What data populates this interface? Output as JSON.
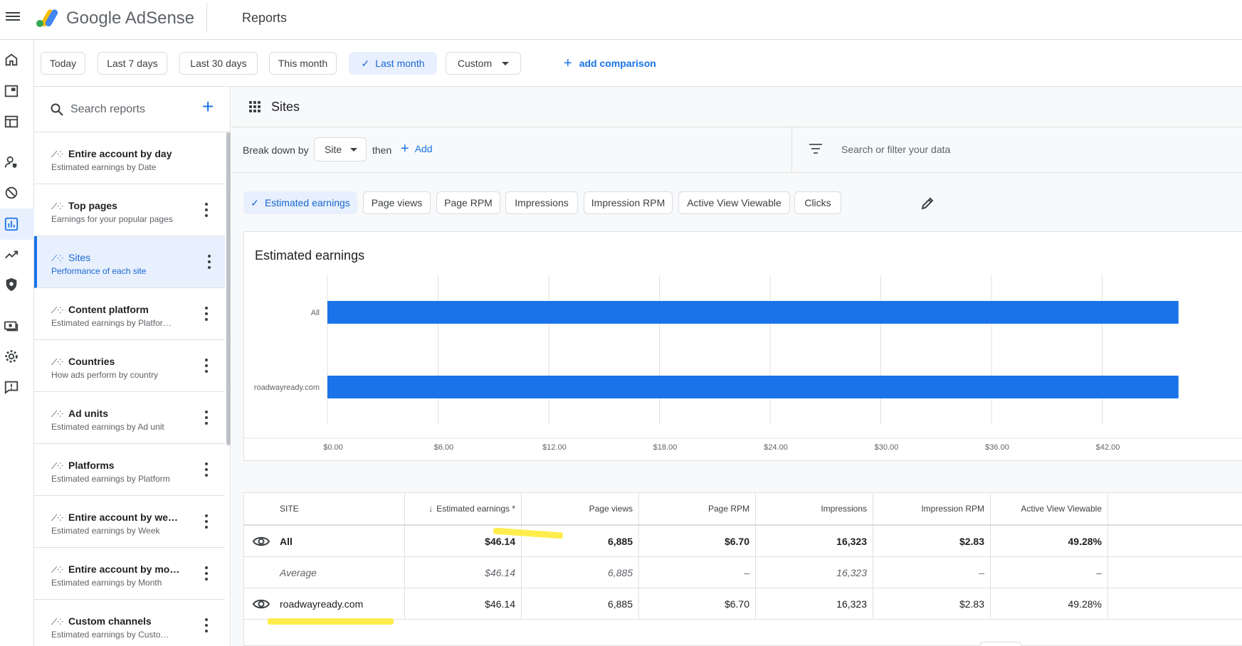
{
  "header": {
    "brand": "Google AdSense",
    "page_title": "Reports"
  },
  "rail": {
    "icons": [
      "home-icon",
      "ads-icon",
      "sites-icon",
      "privacy-icon",
      "block-icon",
      "reports-icon",
      "optimization-icon",
      "policy-icon",
      "payments-icon",
      "settings-icon",
      "feedback-icon"
    ]
  },
  "date_range": {
    "options": [
      "Today",
      "Last 7 days",
      "Last 30 days",
      "This month",
      "Last month",
      "Custom"
    ],
    "selected": "Last month",
    "add_comparison": "add comparison"
  },
  "reports_sidebar": {
    "search_placeholder": "Search reports",
    "items": [
      {
        "title": "Entire account by day",
        "subtitle": "Estimated earnings by Date"
      },
      {
        "title": "Top pages",
        "subtitle": "Earnings for your popular pages"
      },
      {
        "title": "Sites",
        "subtitle": "Performance of each site"
      },
      {
        "title": "Content platform",
        "subtitle": "Estimated earnings by Platfor…"
      },
      {
        "title": "Countries",
        "subtitle": "How ads perform by country"
      },
      {
        "title": "Ad units",
        "subtitle": "Estimated earnings by Ad unit"
      },
      {
        "title": "Platforms",
        "subtitle": "Estimated earnings by Platform"
      },
      {
        "title": "Entire account by we…",
        "subtitle": "Estimated earnings by Week"
      },
      {
        "title": "Entire account by mo…",
        "subtitle": "Estimated earnings by Month"
      },
      {
        "title": "Custom channels",
        "subtitle": "Estimated earnings by Custo…"
      }
    ],
    "active_index": 2
  },
  "main": {
    "report_title": "Sites",
    "breakdown_label": "Break down by",
    "breakdown_value": "Site",
    "then_label": "then",
    "add_label": "Add",
    "filter_placeholder": "Search or filter your data",
    "metrics": [
      "Estimated earnings",
      "Page views",
      "Page RPM",
      "Impressions",
      "Impression RPM",
      "Active View Viewable",
      "Clicks"
    ],
    "selected_metric": "Estimated earnings"
  },
  "chart_data": {
    "type": "bar",
    "orientation": "horizontal",
    "title": "Estimated earnings",
    "categories": [
      "All",
      "roadwayready.com"
    ],
    "values": [
      46.14,
      46.14
    ],
    "x_ticks": [
      "$0.00",
      "$6.00",
      "$12.00",
      "$18.00",
      "$24.00",
      "$30.00",
      "$36.00",
      "$42.00"
    ],
    "xlim": [
      0,
      48
    ],
    "grid": true,
    "bar_color": "#1a73e8"
  },
  "table": {
    "columns": [
      "SITE",
      "Estimated earnings *",
      "Page views",
      "Page RPM",
      "Impressions",
      "Impression RPM",
      "Active View Viewable"
    ],
    "rows": [
      {
        "site": "All",
        "values": [
          "$46.14",
          "6,885",
          "$6.70",
          "16,323",
          "$2.83",
          "49.28%"
        ]
      },
      {
        "site": "Average",
        "values": [
          "$46.14",
          "6,885",
          "–",
          "16,323",
          "–",
          "–"
        ]
      },
      {
        "site": "roadwayready.com",
        "values": [
          "$46.14",
          "6,885",
          "$6.70",
          "16,323",
          "$2.83",
          "49.28%"
        ]
      }
    ]
  },
  "colors": {
    "accent": "#1a73e8",
    "highlight": "#ffeb3b"
  }
}
